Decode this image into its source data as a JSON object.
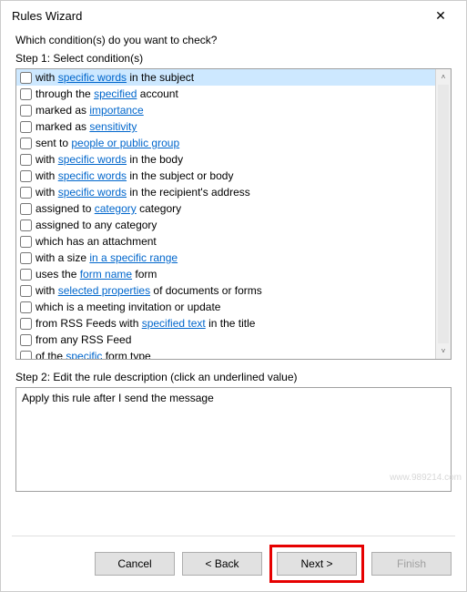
{
  "window": {
    "title": "Rules Wizard"
  },
  "question": "Which condition(s) do you want to check?",
  "step1": {
    "label": "Step 1: Select condition(s)",
    "items": [
      {
        "pre": "with ",
        "link": "specific words",
        "post": " in the subject",
        "selected": true
      },
      {
        "pre": "through the ",
        "link": "specified",
        "post": " account"
      },
      {
        "pre": "marked as ",
        "link": "importance",
        "post": ""
      },
      {
        "pre": "marked as ",
        "link": "sensitivity",
        "post": ""
      },
      {
        "pre": "sent to ",
        "link": "people or public group",
        "post": ""
      },
      {
        "pre": "with ",
        "link": "specific words",
        "post": " in the body"
      },
      {
        "pre": "with ",
        "link": "specific words",
        "post": " in the subject or body"
      },
      {
        "pre": "with ",
        "link": "specific words",
        "post": " in the recipient's address"
      },
      {
        "pre": "assigned to ",
        "link": "category",
        "post": " category"
      },
      {
        "pre": "assigned to any category",
        "link": "",
        "post": ""
      },
      {
        "pre": "which has an attachment",
        "link": "",
        "post": ""
      },
      {
        "pre": "with a size ",
        "link": "in a specific range",
        "post": ""
      },
      {
        "pre": "uses the ",
        "link": "form name",
        "post": " form"
      },
      {
        "pre": "with ",
        "link": "selected properties",
        "post": " of documents or forms"
      },
      {
        "pre": "which is a meeting invitation or update",
        "link": "",
        "post": ""
      },
      {
        "pre": "from RSS Feeds with ",
        "link": "specified text",
        "post": " in the title"
      },
      {
        "pre": "from any RSS Feed",
        "link": "",
        "post": ""
      },
      {
        "pre": "of the ",
        "link": "specific",
        "post": " form type"
      }
    ]
  },
  "step2": {
    "label": "Step 2: Edit the rule description (click an underlined value)",
    "description": "Apply this rule after I send the message"
  },
  "buttons": {
    "cancel": "Cancel",
    "back": "< Back",
    "next": "Next >",
    "finish": "Finish"
  },
  "watermark": "www.989214.com"
}
